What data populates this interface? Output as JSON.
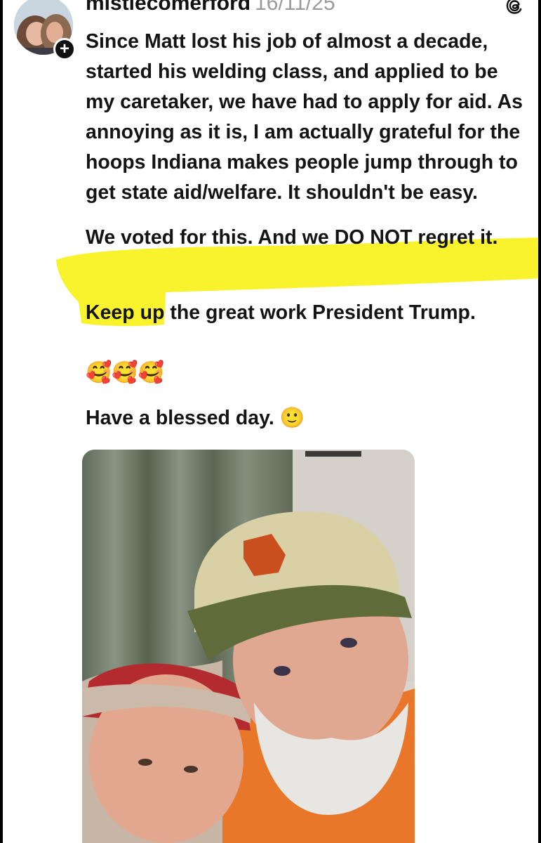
{
  "post": {
    "username": "mistiecomerford",
    "timestamp": "16/11/25",
    "follow_badge": "+",
    "paragraphs": [
      "Since Matt lost his job of almost a decade, started his welding class, and applied to be my caretaker, we have had to apply for aid. As annoying as it is, I am actually grateful for the hoops Indiana makes people jump through to get state aid/welfare. It shouldn't be easy.",
      "We voted for this. And we DO NOT regret it.",
      "Keep up the great work President Trump.",
      "Have a blessed day. 🙂"
    ],
    "emoji_row": "🥰🥰🥰"
  },
  "icons": {
    "avatar": "profile-photo",
    "follow": "plus-badge-icon",
    "app": "threads-logo-icon"
  },
  "colors": {
    "highlight": "#f7f21a",
    "username": "#111111",
    "timestamp": "#9a9a9a",
    "text": "#141414"
  }
}
